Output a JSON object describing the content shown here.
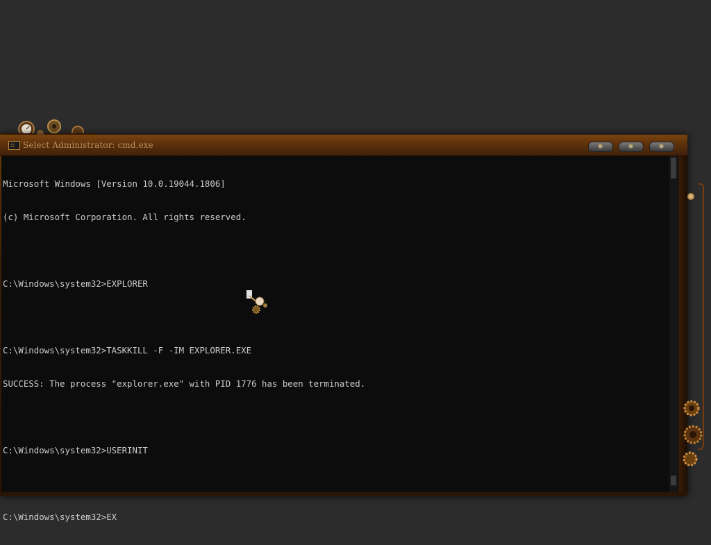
{
  "window": {
    "title": "Select Administrator: cmd.exe"
  },
  "console": {
    "lines": [
      "Microsoft Windows [Version 10.0.19044.1806]",
      "(c) Microsoft Corporation. All rights reserved.",
      "",
      "C:\\Windows\\system32>EXPLORER",
      "",
      "C:\\Windows\\system32>TASKKILL -F -IM EXPLORER.EXE",
      "SUCCESS: The process \"explorer.exe\" with PID 1776 has been terminated.",
      "",
      "C:\\Windows\\system32>USERINIT",
      "",
      "C:\\Windows\\system32>EX"
    ]
  },
  "icons": {
    "app": "console-icon",
    "minimize": "minimize-icon",
    "maximize": "maximize-icon",
    "close": "close-icon",
    "cursor": "gear-cursor-icon"
  },
  "colors": {
    "desktop": "#2c2c2c",
    "frame": "#5a300a",
    "console_bg": "#0c0c0c",
    "console_text": "#cccccc",
    "title_text": "#b89060"
  }
}
